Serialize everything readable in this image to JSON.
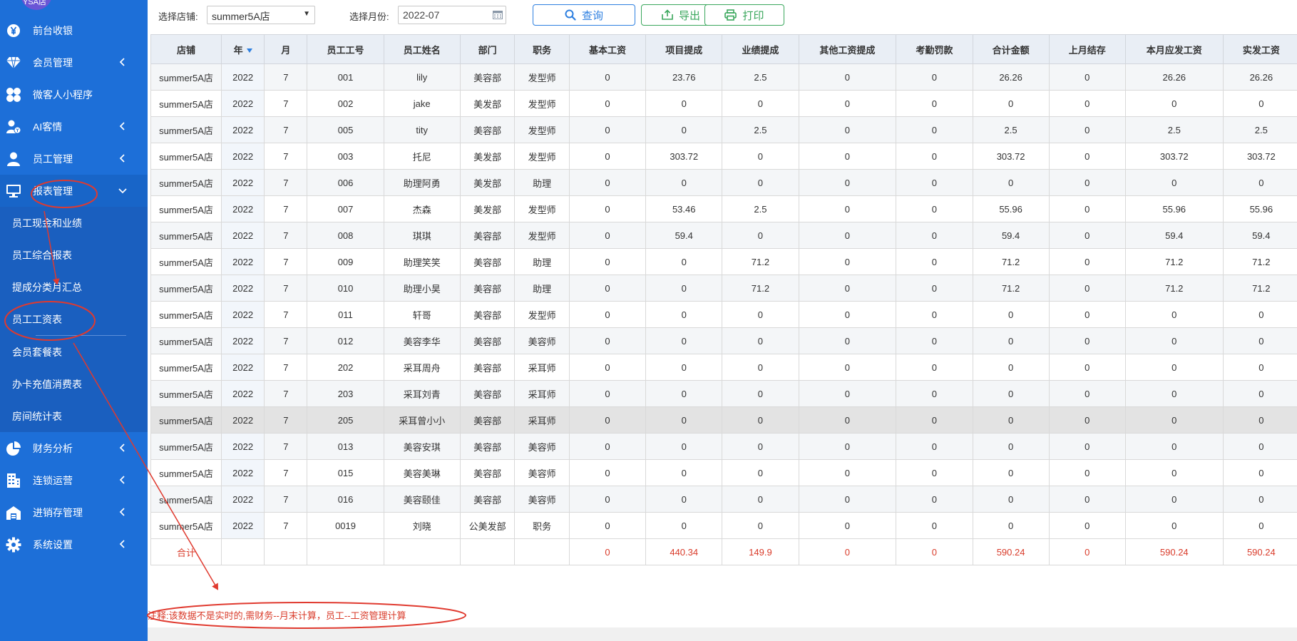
{
  "sidebar": {
    "avatar_text": "YSA店",
    "items": [
      {
        "label": "前台收银",
        "icon": "yen-coin-icon",
        "chevron": false
      },
      {
        "label": "会员管理",
        "icon": "diamond-icon",
        "chevron": true
      },
      {
        "label": "微客人小程序",
        "icon": "clover-icon",
        "chevron": false
      },
      {
        "label": "AI客情",
        "icon": "user-money-icon",
        "chevron": true
      },
      {
        "label": "员工管理",
        "icon": "user-icon",
        "chevron": true
      },
      {
        "label": "报表管理",
        "icon": "monitor-icon",
        "chevron": true
      },
      {
        "label": "财务分析",
        "icon": "pie-chart-icon",
        "chevron": true
      },
      {
        "label": "连锁运营",
        "icon": "building-icon",
        "chevron": true
      },
      {
        "label": "进销存管理",
        "icon": "warehouse-icon",
        "chevron": true
      },
      {
        "label": "系统设置",
        "icon": "gear-icon",
        "chevron": true
      }
    ],
    "report_submenu": [
      "员工现金和业绩",
      "员工综合报表",
      "提成分类月汇总",
      "员工工资表",
      "会员套餐表",
      "办卡充值消费表",
      "房间统计表"
    ]
  },
  "toolbar": {
    "store_label": "选择店铺:",
    "store_value": "summer5A店",
    "month_label": "选择月份:",
    "month_value": "2022-07",
    "query_label": "查询",
    "export_label": "导出",
    "print_label": "打印"
  },
  "table": {
    "headers": [
      "店铺",
      "年",
      "月",
      "员工工号",
      "员工姓名",
      "部门",
      "职务",
      "基本工资",
      "项目提成",
      "业绩提成",
      "其他工资提成",
      "考勤罚款",
      "合计金额",
      "上月结存",
      "本月应发工资",
      "实发工资"
    ],
    "rows": [
      [
        "summer5A店",
        "2022",
        "7",
        "001",
        "lily",
        "美容部",
        "发型师",
        "0",
        "23.76",
        "2.5",
        "0",
        "0",
        "26.26",
        "0",
        "26.26",
        "26.26"
      ],
      [
        "summer5A店",
        "2022",
        "7",
        "002",
        "jake",
        "美发部",
        "发型师",
        "0",
        "0",
        "0",
        "0",
        "0",
        "0",
        "0",
        "0",
        "0"
      ],
      [
        "summer5A店",
        "2022",
        "7",
        "005",
        "tity",
        "美容部",
        "发型师",
        "0",
        "0",
        "2.5",
        "0",
        "0",
        "2.5",
        "0",
        "2.5",
        "2.5"
      ],
      [
        "summer5A店",
        "2022",
        "7",
        "003",
        "托尼",
        "美发部",
        "发型师",
        "0",
        "303.72",
        "0",
        "0",
        "0",
        "303.72",
        "0",
        "303.72",
        "303.72"
      ],
      [
        "summer5A店",
        "2022",
        "7",
        "006",
        "助理阿勇",
        "美发部",
        "助理",
        "0",
        "0",
        "0",
        "0",
        "0",
        "0",
        "0",
        "0",
        "0"
      ],
      [
        "summer5A店",
        "2022",
        "7",
        "007",
        "杰森",
        "美发部",
        "发型师",
        "0",
        "53.46",
        "2.5",
        "0",
        "0",
        "55.96",
        "0",
        "55.96",
        "55.96"
      ],
      [
        "summer5A店",
        "2022",
        "7",
        "008",
        "琪琪",
        "美容部",
        "发型师",
        "0",
        "59.4",
        "0",
        "0",
        "0",
        "59.4",
        "0",
        "59.4",
        "59.4"
      ],
      [
        "summer5A店",
        "2022",
        "7",
        "009",
        "助理笑笑",
        "美容部",
        "助理",
        "0",
        "0",
        "71.2",
        "0",
        "0",
        "71.2",
        "0",
        "71.2",
        "71.2"
      ],
      [
        "summer5A店",
        "2022",
        "7",
        "010",
        "助理小昊",
        "美容部",
        "助理",
        "0",
        "0",
        "71.2",
        "0",
        "0",
        "71.2",
        "0",
        "71.2",
        "71.2"
      ],
      [
        "summer5A店",
        "2022",
        "7",
        "011",
        "轩哥",
        "美容部",
        "发型师",
        "0",
        "0",
        "0",
        "0",
        "0",
        "0",
        "0",
        "0",
        "0"
      ],
      [
        "summer5A店",
        "2022",
        "7",
        "012",
        "美容李华",
        "美容部",
        "美容师",
        "0",
        "0",
        "0",
        "0",
        "0",
        "0",
        "0",
        "0",
        "0"
      ],
      [
        "summer5A店",
        "2022",
        "7",
        "202",
        "采耳周舟",
        "美容部",
        "采耳师",
        "0",
        "0",
        "0",
        "0",
        "0",
        "0",
        "0",
        "0",
        "0"
      ],
      [
        "summer5A店",
        "2022",
        "7",
        "203",
        "采耳刘青",
        "美容部",
        "采耳师",
        "0",
        "0",
        "0",
        "0",
        "0",
        "0",
        "0",
        "0",
        "0"
      ],
      [
        "summer5A店",
        "2022",
        "7",
        "205",
        "采耳曾小小",
        "美容部",
        "采耳师",
        "0",
        "0",
        "0",
        "0",
        "0",
        "0",
        "0",
        "0",
        "0"
      ],
      [
        "summer5A店",
        "2022",
        "7",
        "013",
        "美容安琪",
        "美容部",
        "美容师",
        "0",
        "0",
        "0",
        "0",
        "0",
        "0",
        "0",
        "0",
        "0"
      ],
      [
        "summer5A店",
        "2022",
        "7",
        "015",
        "美容美琳",
        "美容部",
        "美容师",
        "0",
        "0",
        "0",
        "0",
        "0",
        "0",
        "0",
        "0",
        "0"
      ],
      [
        "summer5A店",
        "2022",
        "7",
        "016",
        "美容颐佳",
        "美容部",
        "美容师",
        "0",
        "0",
        "0",
        "0",
        "0",
        "0",
        "0",
        "0",
        "0"
      ],
      [
        "summer5A店",
        "2022",
        "7",
        "0019",
        "刘晓",
        "公美发部",
        "职务",
        "0",
        "0",
        "0",
        "0",
        "0",
        "0",
        "0",
        "0",
        "0"
      ]
    ],
    "highlighted_row": 13,
    "total_row": [
      "合计",
      "",
      "",
      "",
      "",
      "",
      "",
      "0",
      "440.34",
      "149.9",
      "0",
      "0",
      "590.24",
      "0",
      "590.24",
      "590.24"
    ]
  },
  "note": "注释:该数据不是实时的,需财务--月末计算，员工--工资管理计算",
  "colors": {
    "sidebar_bg": "#1d6fd8",
    "annotation_red": "#e03a2f",
    "query_blue": "#2d7fe0",
    "action_green": "#3aa75c",
    "total_red": "#d93b2a"
  }
}
